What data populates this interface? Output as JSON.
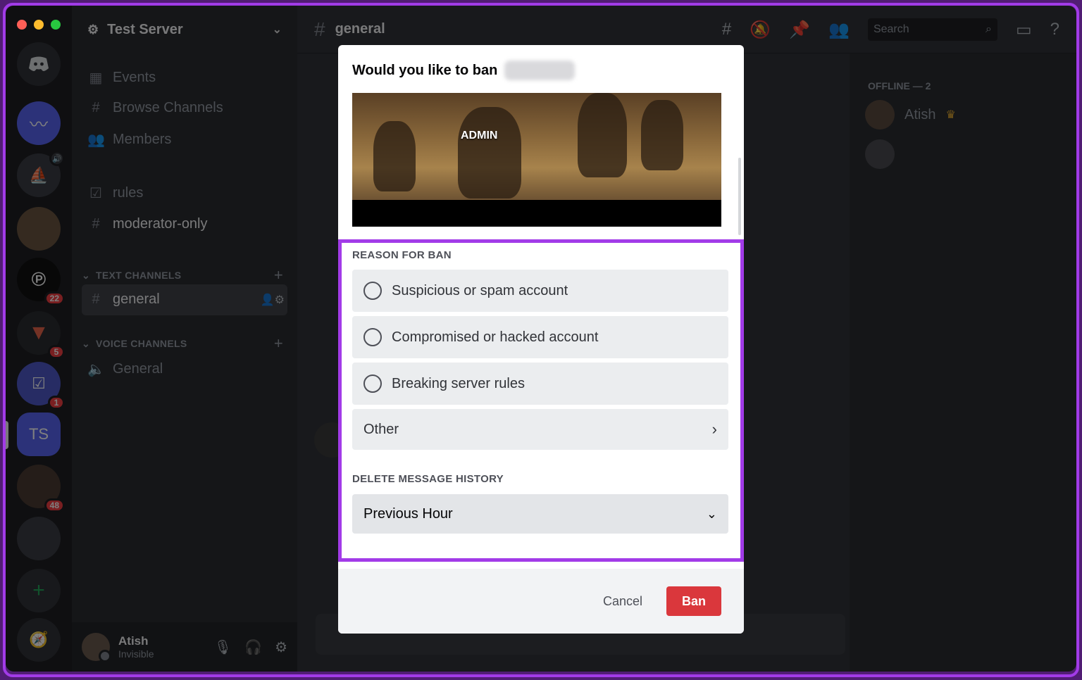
{
  "server": {
    "name": "Test Server",
    "rail": [
      {
        "name": "discord-home"
      },
      {
        "name": "server-mustache"
      },
      {
        "name": "server-sailboat"
      },
      {
        "name": "server-avatar-1"
      },
      {
        "name": "server-p",
        "badge": "22"
      },
      {
        "name": "server-triangle",
        "badge": "5"
      },
      {
        "name": "server-check",
        "badge": "1"
      },
      {
        "name": "server-ts",
        "label": "TS"
      },
      {
        "name": "server-avatar-2",
        "badge": "48"
      },
      {
        "name": "server-dark"
      }
    ]
  },
  "sidebar": {
    "nav": [
      "Events",
      "Browse Channels",
      "Members"
    ],
    "channels_top": [
      "rules",
      "moderator-only"
    ],
    "text_category": "TEXT CHANNELS",
    "text_channel": "general",
    "voice_category": "VOICE CHANNELS",
    "voice_channel": "General"
  },
  "user": {
    "name": "Atish",
    "status": "Invisible"
  },
  "topbar": {
    "channel": "general",
    "search_placeholder": "Search"
  },
  "members": {
    "heading": "OFFLINE — 2",
    "first": "Atish"
  },
  "modal": {
    "title": "Would you like to ban",
    "gif_label": "ADMIN",
    "reason_label": "REASON FOR BAN",
    "options": [
      "Suspicious or spam account",
      "Compromised or hacked account",
      "Breaking server rules"
    ],
    "other": "Other",
    "history_label": "DELETE MESSAGE HISTORY",
    "history_value": "Previous Hour",
    "cancel": "Cancel",
    "ban": "Ban"
  },
  "colors": {
    "accent": "#a23be8",
    "danger": "#da373c"
  }
}
